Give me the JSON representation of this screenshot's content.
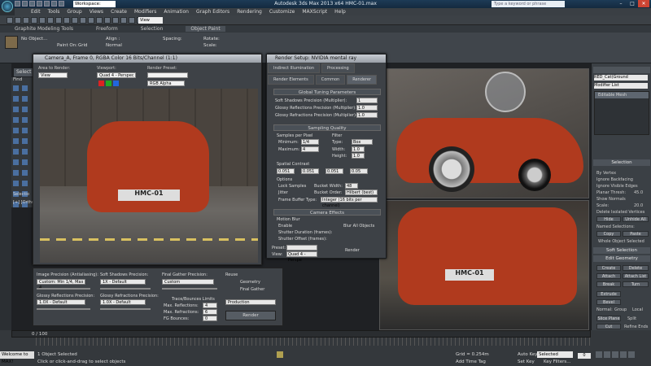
{
  "app": {
    "title": "Autodesk 3ds Max  2013 x64      HMC-01.max",
    "workspace": "Workspace: Default",
    "search_placeholder": "Type a keyword or phrase"
  },
  "menu": [
    "Edit",
    "Tools",
    "Group",
    "Views",
    "Create",
    "Modifiers",
    "Animation",
    "Graph Editors",
    "Rendering",
    "Customize",
    "MAXScript",
    "Help"
  ],
  "ribbon": {
    "tabs": [
      "Graphite Modeling Tools",
      "Freeform",
      "Selection",
      "Object Paint"
    ],
    "no_object": "No Object...",
    "paint_on": "Paint On:",
    "grid_label": "Grid",
    "align_label": "Align :",
    "normal_label": "Normal",
    "scale_label": "Scale:",
    "rotate_label": "Rotate:",
    "spacing_label": "Spacing:"
  },
  "viewport": {
    "selection_tab": "Select",
    "find_label": "Find",
    "ortho_label": "[+] [Ortho]",
    "selection_label": "Selectio"
  },
  "render_window": {
    "title": "Camera_A, Frame 0, RGBA Color 16 Bits/Channel (1:1)",
    "area_label": "Area to Render:",
    "area_value": "View",
    "viewport_label": "Viewport:",
    "viewport_value": "Quad 4 - Perspec",
    "preset_label": "Render Preset:",
    "channel_value": "RGB Alpha",
    "plate_text": "HMC-01"
  },
  "render_setup": {
    "title": "Render Setup: NVIDIA mental ray",
    "tabs": [
      "Indirect Illumination",
      "Processing",
      "Render Elements",
      "Common",
      "Renderer"
    ],
    "sections": {
      "global_tuning": "Global Tuning Parameters",
      "sampling": "Sampling Quality",
      "camera_effects": "Camera Effects"
    },
    "soft_shadow": "Soft Shadows Precision (Multiplier):",
    "soft_shadow_val": "1",
    "glossy_refl": "Glossy Reflections Precision (Multiplier):",
    "glossy_refl_val": "1.0",
    "glossy_refr": "Glossy Refractions Precision (Multiplier):",
    "glossy_refr_val": "1.0",
    "samples_per_pixel": "Samples per Pixel",
    "filter": "Filter",
    "minimum": "Minimum:",
    "minimum_val": "1/4",
    "maximum": "Maximum:",
    "maximum_val": "4",
    "type": "Type:",
    "type_val": "Box",
    "width": "Width:",
    "width_val": "1.0",
    "height": "Height:",
    "height_val": "1.0",
    "spatial_contrast": "Spatial Contrast",
    "contrast_vals": [
      "0.051",
      "0.051",
      "0.051",
      "0.05"
    ],
    "options": "Options",
    "lock_samples": "Lock Samples",
    "jitter": "Jitter",
    "bucket_width": "Bucket Width:",
    "bucket_width_val": "48",
    "bucket_order": "Bucket Order:",
    "bucket_order_val": "Hilbert (best)",
    "frame_buffer": "Frame Buffer Type:",
    "frame_buffer_val": "Integer (16 bits per channel)",
    "motion_blur": "Motion Blur",
    "enable": "Enable",
    "blur_all": "Blur All Objects",
    "shutter_duration": "Shutter Duration (frames):",
    "shutter_offset": "Shutter Offset (frames):",
    "preset_label": "Preset:",
    "view_label": "View:",
    "view_value": "Quad 4 - Perspe",
    "render_button": "Render"
  },
  "bottom_panel": {
    "image_precision": "Image Precision (Antialiasing):",
    "image_precision_val": "Custom: Min 1/4, Max 4",
    "soft_shadows": "Soft Shadows Precision:",
    "soft_shadows_val": "1X - Default",
    "final_gather": "Final Gather Precision:",
    "final_gather_val": "Custom",
    "reuse": "Reuse",
    "geometry": "Geometry",
    "final_gather_chk": "Final Gather",
    "glossy_refl": "Glossy Reflections Precision:",
    "glossy_refl_val": "1.0X - Default",
    "glossy_refr": "Glossy Refractions Precision:",
    "glossy_refr_val": "1.0X - Default",
    "trace_limits": "Trace/Bounces Limits",
    "max_reflections": "Max. Reflections:",
    "max_reflections_val": "4",
    "max_refractions": "Max. Refractions:",
    "max_refractions_val": "6",
    "fg_bounces": "FG Bounces:",
    "fg_bounces_val": "0",
    "production": "Production",
    "render_button": "Render"
  },
  "command_panel": {
    "object_name": "RED_Cat(Ground",
    "modifier_list": "Modifier List",
    "editable_mesh": "Editable Mesh",
    "selection_head": "Selection",
    "by_vertex": "By Vertex",
    "ignore_backfacing": "Ignore Backfacing",
    "ignore_visible_edges": "Ignore Visible Edges",
    "planar_thresh": "Planar Thresh:",
    "planar_thresh_val": "45.0",
    "show_normals": "Show Normals",
    "scale_label": "Scale:",
    "scale_val": "20.0",
    "delete_isolated": "Delete Isolated Vertices",
    "hide": "Hide",
    "unhide_all": "Unhide All",
    "named_selections": "Named Selections:",
    "copy": "Copy",
    "paste": "Paste",
    "whole_object": "Whole Object Selected",
    "soft_selection": "Soft Selection",
    "edit_geometry": "Edit Geometry",
    "create": "Create",
    "delete": "Delete",
    "attach": "Attach",
    "detach": "Detach",
    "attach_list": "Attach List",
    "break": "Break",
    "turn": "Turn",
    "extrude": "Extrude",
    "bevel": "Bevel",
    "normal": "Normal:",
    "group": "Group",
    "local": "Local",
    "slice_plane": "Slice Plane",
    "cut": "Cut",
    "split": "Split",
    "refine_ends": "Refine Ends",
    "weld": "Weld"
  },
  "status": {
    "frame_range": "0 / 100",
    "objects_selected": "1 Object Selected",
    "hint": "Click or click-and-drag to select objects",
    "grid": "Grid = 0.254m",
    "auto_key": "Auto Key",
    "selected": "Selected",
    "set_key": "Set Key",
    "key_filters": "Key Filters...",
    "add_time_tag": "Add Time Tag",
    "welcome": "Welcome to MAX!",
    "time_display": "0"
  }
}
